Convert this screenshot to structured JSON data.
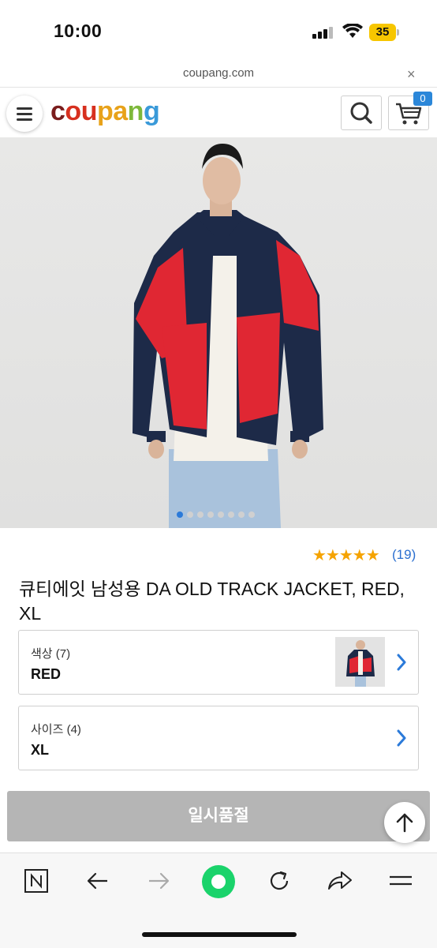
{
  "status_bar": {
    "time": "10:00",
    "battery": "35"
  },
  "browser": {
    "url": "coupang.com",
    "close_glyph": "×"
  },
  "header": {
    "logo": [
      "c",
      "ou",
      "pa",
      "n",
      "g"
    ],
    "cart_count": "0"
  },
  "product": {
    "rating_stars": "★★★★★",
    "rating_count": "(19)",
    "title": "큐티에잇 남성용 DA OLD TRACK JACKET, RED, XL",
    "image_count": 8,
    "active_image": 1
  },
  "options": {
    "color": {
      "label": "색상 (7)",
      "value": "RED"
    },
    "size": {
      "label": "사이즈 (4)",
      "value": "XL"
    }
  },
  "actions": {
    "soldout_label": "일시품절"
  },
  "colors": {
    "accent_blue": "#2b7ad9",
    "star": "#f5a300",
    "soldout_bg": "#b5b5b5"
  }
}
